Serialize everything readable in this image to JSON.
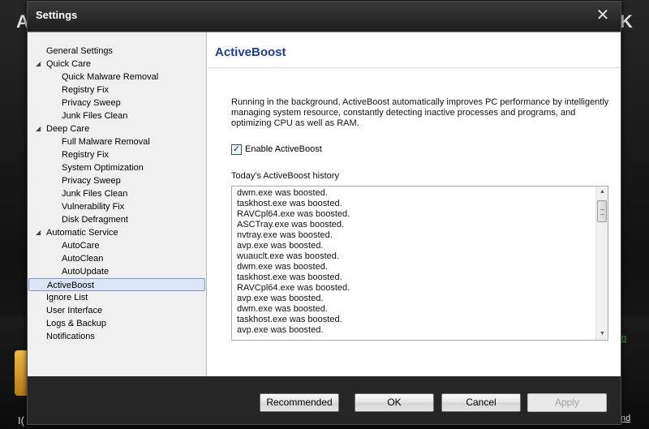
{
  "background": {
    "left_text": "A",
    "right_text": "K",
    "link_right": "n",
    "bottom_left": "I(",
    "bottom_right": "nd"
  },
  "dialog": {
    "title": "Settings",
    "close_icon": "close-icon"
  },
  "sidebar": {
    "items": [
      {
        "label": "General Settings",
        "level": 0,
        "expanded": null
      },
      {
        "label": "Quick Care",
        "level": 0,
        "expanded": true
      },
      {
        "label": "Quick Malware Removal",
        "level": 1
      },
      {
        "label": "Registry Fix",
        "level": 1
      },
      {
        "label": "Privacy Sweep",
        "level": 1
      },
      {
        "label": "Junk Files Clean",
        "level": 1
      },
      {
        "label": "Deep Care",
        "level": 0,
        "expanded": true
      },
      {
        "label": "Full Malware Removal",
        "level": 1
      },
      {
        "label": "Registry Fix",
        "level": 1
      },
      {
        "label": "System Optimization",
        "level": 1
      },
      {
        "label": "Privacy Sweep",
        "level": 1
      },
      {
        "label": "Junk Files Clean",
        "level": 1
      },
      {
        "label": "Vulnerability Fix",
        "level": 1
      },
      {
        "label": "Disk Defragment",
        "level": 1
      },
      {
        "label": "Automatic Service",
        "level": 0,
        "expanded": true
      },
      {
        "label": "AutoCare",
        "level": 1
      },
      {
        "label": "AutoClean",
        "level": 1
      },
      {
        "label": "AutoUpdate",
        "level": 1
      },
      {
        "label": "ActiveBoost",
        "level": 0,
        "selected": true
      },
      {
        "label": "Ignore List",
        "level": 0
      },
      {
        "label": "User Interface",
        "level": 0
      },
      {
        "label": "Logs & Backup",
        "level": 0
      },
      {
        "label": "Notifications",
        "level": 0
      }
    ]
  },
  "content": {
    "title": "ActiveBoost",
    "description": "Running in the background, ActiveBoost automatically improves PC performance by intelligently managing system resource, constantly detecting inactive processes and programs, and optimizing CPU as well as RAM.",
    "enable_label": "Enable ActiveBoost",
    "enable_checked": true,
    "history_label": "Today's ActiveBoost history",
    "history": [
      "dwm.exe was boosted.",
      "taskhost.exe was boosted.",
      "RAVCpl64.exe was boosted.",
      "ASCTray.exe was boosted.",
      "nvtray.exe was boosted.",
      "avp.exe was boosted.",
      "wuauclt.exe was boosted.",
      "dwm.exe was boosted.",
      "taskhost.exe was boosted.",
      "RAVCpl64.exe was boosted.",
      "avp.exe was boosted.",
      "dwm.exe was boosted.",
      "taskhost.exe was boosted.",
      "avp.exe was boosted."
    ]
  },
  "footer": {
    "recommended_label": "Recommended",
    "ok_label": "OK",
    "cancel_label": "Cancel",
    "apply_label": "Apply"
  },
  "colors": {
    "title_accent": "#1d3d8c",
    "selected_bg": "#dce5f5",
    "selected_border": "#7d97c7",
    "link_green": "#3cb34a"
  }
}
